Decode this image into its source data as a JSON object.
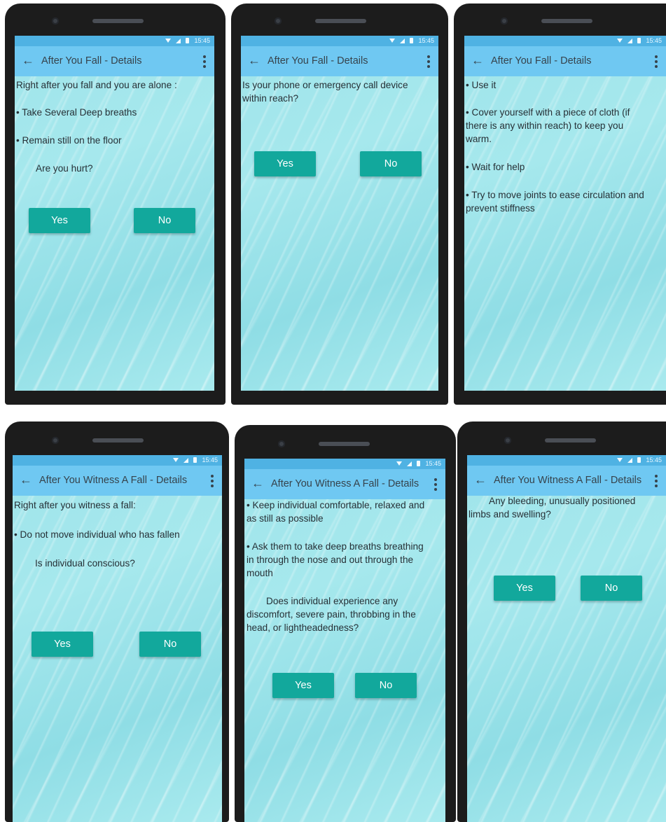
{
  "status": {
    "time": "15:45"
  },
  "screens": [
    {
      "title": "After You Fall - Details",
      "lines": [
        "Right after you fall and you are alone :",
        "• Take Several Deep breaths",
        "• Remain still on the floor",
        "Are you hurt?"
      ],
      "yes": "Yes",
      "no": "No"
    },
    {
      "title": "After You Fall - Details",
      "lines": [
        "Is your phone or emergency call device",
        "within reach?"
      ],
      "yes": "Yes",
      "no": "No"
    },
    {
      "title": "After You Fall - Details",
      "lines": [
        "• Use it",
        "• Cover yourself with a piece of cloth (if",
        "there is any within reach) to keep you",
        "warm.",
        "• Wait for help",
        "• Try to move joints to ease circulation and",
        "prevent stiffness"
      ]
    },
    {
      "title": "After You Witness A Fall - Details",
      "lines": [
        "Right after you witness a fall:",
        "• Do not move individual who has fallen",
        "Is individual conscious?"
      ],
      "yes": "Yes",
      "no": "No"
    },
    {
      "title": "After You Witness A Fall - Details",
      "lines": [
        "• Keep individual comfortable, relaxed and",
        "as still as possible",
        "• Ask them to take deep breaths breathing",
        "in through the nose and out through the",
        "mouth",
        "Does individual experience any",
        "discomfort, severe pain, throbbing in the",
        "head, or lightheadedness?"
      ],
      "yes": "Yes",
      "no": "No"
    },
    {
      "title": "After You Witness A Fall - Details",
      "lines": [
        "Any bleeding, unusually positioned",
        "limbs and swelling?"
      ],
      "yes": "Yes",
      "no": "No"
    }
  ]
}
